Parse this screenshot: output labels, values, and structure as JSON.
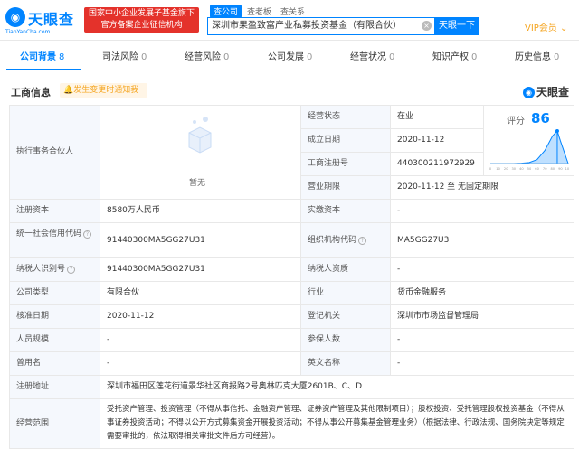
{
  "header": {
    "logo_text": "天眼查",
    "logo_sub": "TianYanCha.com",
    "gov_badge_line1": "国家中小企业发展子基金旗下",
    "gov_badge_line2": "官方备案企业征信机构",
    "search_tabs": [
      "查公司",
      "查老板",
      "查关系"
    ],
    "search_value": "深圳市果盈致富产业私募投资基金（有限合伙）",
    "search_button": "天眼一下",
    "vip_label": "VIP会员"
  },
  "tabs": [
    {
      "label": "公司背景",
      "count": "8"
    },
    {
      "label": "司法风险",
      "count": "0"
    },
    {
      "label": "经营风险",
      "count": "0"
    },
    {
      "label": "公司发展",
      "count": "0"
    },
    {
      "label": "经营状况",
      "count": "0"
    },
    {
      "label": "知识产权",
      "count": "0"
    },
    {
      "label": "历史信息",
      "count": "0"
    }
  ],
  "section": {
    "title": "工商信息",
    "notice": "发生变更时通知我",
    "brand": "天眼查"
  },
  "info": {
    "partner_label": "执行事务合伙人",
    "partner_empty": "暂无",
    "status_label": "经营状态",
    "status_value": "在业",
    "founded_label": "成立日期",
    "founded_value": "2020-11-12",
    "regno_label": "工商注册号",
    "regno_value": "440300211972929",
    "term_label": "营业期限",
    "term_value": "2020-11-12 至 无固定期限",
    "score_label": "评分",
    "score_value": "86",
    "reg_capital_label": "注册资本",
    "reg_capital_value": "8580万人民币",
    "paid_capital_label": "实缴资本",
    "paid_capital_value": "-",
    "credit_code_label": "统一社会信用代码",
    "credit_code_value": "91440300MA5GG27U31",
    "org_code_label": "组织机构代码",
    "org_code_value": "MA5GG27U3",
    "taxpayer_id_label": "纳税人识别号",
    "taxpayer_id_value": "91440300MA5GG27U31",
    "taxpayer_qual_label": "纳税人资质",
    "taxpayer_qual_value": "-",
    "company_type_label": "公司类型",
    "company_type_value": "有限合伙",
    "industry_label": "行业",
    "industry_value": "货币金融服务",
    "approval_label": "核准日期",
    "approval_value": "2020-11-12",
    "authority_label": "登记机关",
    "authority_value": "深圳市市场监督管理局",
    "staff_label": "人员规模",
    "staff_value": "-",
    "insured_label": "参保人数",
    "insured_value": "-",
    "former_name_label": "曾用名",
    "former_name_value": "-",
    "en_name_label": "英文名称",
    "en_name_value": "-",
    "address_label": "注册地址",
    "address_value": "深圳市福田区莲花街道景华社区商报路2号奥林匹克大厦2601B、C、D",
    "scope_label": "经营范围",
    "scope_value": "受托资产管理、投资管理（不得从事信托、金融资产管理、证券资产管理及其他限制项目）；股权投资、受托管理股权投资基金（不得从事证券投资活动；不得以公开方式募集资金开展投资活动；不得从事公开募集基金管理业务）（根据法律、行政法规、国务院决定等规定需要审批的，依法取得相关审批文件后方可经营）。"
  },
  "chart_data": {
    "type": "area",
    "x": [
      0,
      10,
      20,
      30,
      40,
      50,
      60,
      70,
      80,
      86,
      90,
      100
    ],
    "values": [
      0,
      0,
      0,
      0,
      0.01,
      0.03,
      0.12,
      0.4,
      0.85,
      1.0,
      0.7,
      0
    ],
    "marker": 86,
    "xlim": [
      0,
      100
    ],
    "tick_labels": [
      "0",
      "10",
      "20",
      "30",
      "40",
      "50",
      "60",
      "70",
      "80",
      "90",
      "100"
    ],
    "color": "#0084ff"
  }
}
